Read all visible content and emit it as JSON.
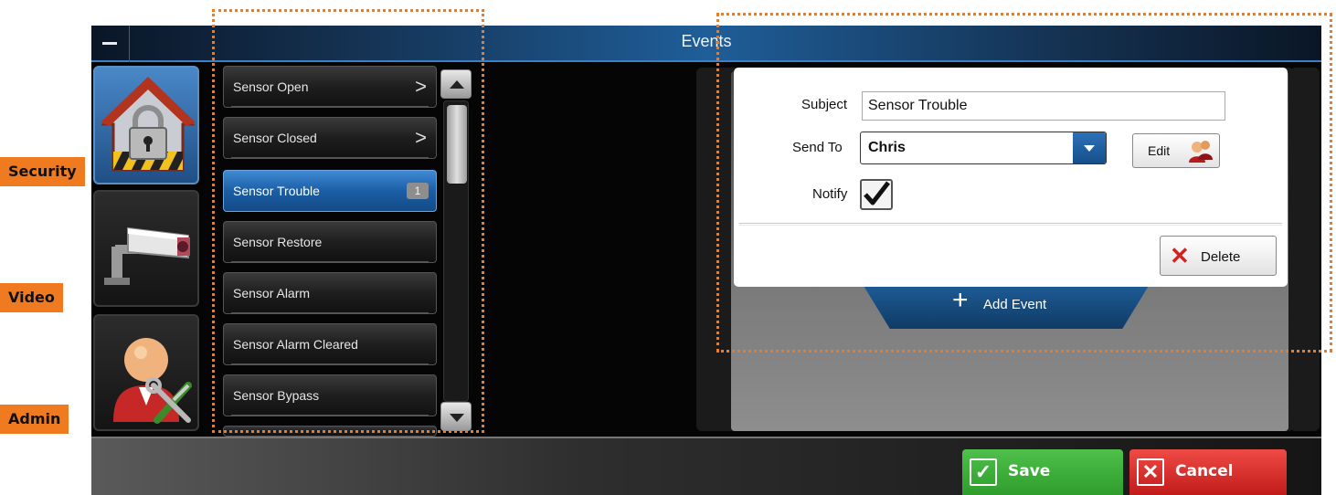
{
  "window": {
    "title": "Events"
  },
  "nav": {
    "items": [
      {
        "label": "Security",
        "icon": "house-lock-icon"
      },
      {
        "label": "Video",
        "icon": "security-camera-icon"
      },
      {
        "label": "Admin",
        "icon": "admin-tools-icon"
      }
    ]
  },
  "events": {
    "items": [
      {
        "label": "Sensor Open",
        "indicator": ">"
      },
      {
        "label": "Sensor Closed",
        "indicator": ">"
      },
      {
        "label": "Sensor Trouble",
        "count": "1",
        "selected": true
      },
      {
        "label": "Sensor Restore"
      },
      {
        "label": "Sensor Alarm"
      },
      {
        "label": "Sensor Alarm Cleared"
      },
      {
        "label": "Sensor Bypass"
      }
    ]
  },
  "detail": {
    "subject_label": "Subject",
    "subject_value": "Sensor Trouble",
    "sendto_label": "Send To",
    "sendto_value": "Chris",
    "edit_label": "Edit",
    "notify_label": "Notify",
    "notify_checked": true,
    "delete_label": "Delete",
    "add_event_label": "Add Event"
  },
  "footer": {
    "save_label": "Save",
    "cancel_label": "Cancel"
  },
  "colors": {
    "annotation": "#f07a1f",
    "save": "#3aa837",
    "cancel": "#d9302d",
    "selection": "#1b5ea5"
  }
}
